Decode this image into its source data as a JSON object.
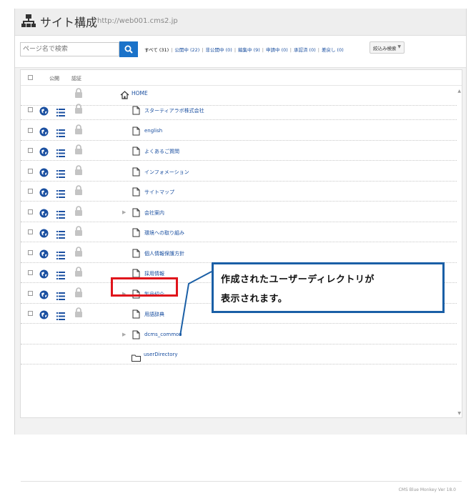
{
  "header": {
    "title": "サイト構成",
    "url": "http://web001.cms2.jp"
  },
  "toolbar": {
    "search_placeholder": "ページ名で検索",
    "filters": [
      {
        "label": "すべて (31)",
        "active": true
      },
      {
        "label": "公開中 (22)",
        "active": false
      },
      {
        "label": "非公開中 (0)",
        "active": false
      },
      {
        "label": "編集中 (9)",
        "active": false
      },
      {
        "label": "申請中 (0)",
        "active": false
      },
      {
        "label": "承認済 (0)",
        "active": false
      },
      {
        "label": "差戻し (0)",
        "active": false
      }
    ],
    "filter_select": "絞込み検索"
  },
  "columns": {
    "public": "公開",
    "auth": "認証"
  },
  "tree": {
    "home": "HOME",
    "pages": [
      {
        "name": "スターティアラボ株式会社"
      },
      {
        "name": "english"
      },
      {
        "name": "よくあるご質問"
      },
      {
        "name": "インフォメーション"
      },
      {
        "name": "サイトマップ"
      },
      {
        "name": "会社案内"
      },
      {
        "name": "環境への取り組み"
      },
      {
        "name": "個人情報保護方針"
      },
      {
        "name": "採用情報"
      },
      {
        "name": "製品紹介"
      },
      {
        "name": "用語辞典"
      },
      {
        "name": "dcms_common"
      }
    ],
    "user_directory": "userDirectory"
  },
  "callout": {
    "line1": "作成されたユーザーディレクトリが",
    "line2": "表示されます。"
  },
  "footer": "CMS Blue Monkey Ver 18.0",
  "colors": {
    "accent": "#1a72c9",
    "highlight": "#e0141c",
    "callout_border": "#1a5fa6"
  }
}
